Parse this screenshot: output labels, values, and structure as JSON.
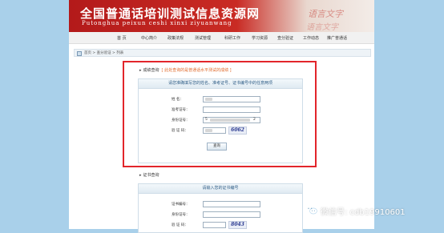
{
  "site": {
    "title": "全国普通话培训测试信息资源网",
    "pinyin": "Putonghua  peixun  ceshi  xinxi  ziyuanwang",
    "banner_art": [
      "语言文字",
      "语言文字"
    ]
  },
  "nav": [
    "首  页",
    "中心简介",
    "政策法规",
    "测试管理",
    "科研工作",
    "学习资源",
    "查分验证",
    "工作动态",
    "推广普通话"
  ],
  "breadcrumb": "首页 > 查分验证 > 列表",
  "score_section": {
    "title": "成绩查询",
    "note": "[ 此处查询的是普通话水平测试的成绩 ]",
    "panel_header": "请您准确填写您的姓名、准考证号、证书编号中的任意两项",
    "fields": {
      "name_label": "姓    名：",
      "exam_label": "准考证号：",
      "id_label": "身份证号：",
      "id_prefix": "5",
      "id_suffix": "2",
      "captcha_label": "验 证 码：",
      "captcha_image": "6062"
    },
    "submit": "查询"
  },
  "cert_section": {
    "title": "证书查询",
    "panel_header": "请输入您的证书编号",
    "fields": {
      "cert_label": "证书编号：",
      "id_label": "身份证号：",
      "captcha_label": "验 证 码：",
      "captcha_image": "8043"
    }
  },
  "watermark": "微信号: cdb19910601"
}
